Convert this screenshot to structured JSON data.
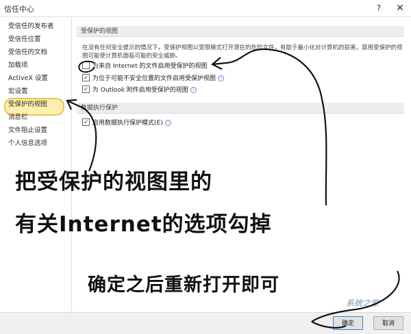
{
  "window": {
    "title": "信任中心",
    "help_label": "?",
    "close_label": "✕"
  },
  "sidebar": {
    "items": [
      {
        "label": "受信任的发布者"
      },
      {
        "label": "受信任位置"
      },
      {
        "label": "受信任的文档"
      },
      {
        "label": "加载项"
      },
      {
        "label": "ActiveX 设置"
      },
      {
        "label": "宏设置"
      },
      {
        "label": "受保护的视图"
      },
      {
        "label": "消息栏"
      },
      {
        "label": "文件阻止设置"
      },
      {
        "label": "个人信息选项"
      }
    ],
    "active_index": 6
  },
  "protected_view": {
    "header": "受保护的视图",
    "description": "在没有任何安全提示的情况下，受保护视图以受限模式打开潜在的危险文件，有助于最小化对计算机的损害。禁用受保护的视图可能使计算机面临可能的安全威胁。",
    "options": [
      {
        "label": "为来自 Internet 的文件启用受保护的视图",
        "checked": false,
        "info": false
      },
      {
        "label": "为位于可能不安全位置的文件启用受保护视图",
        "checked": true,
        "info": true
      },
      {
        "label": "为 Outlook 附件启用受保护的视图",
        "checked": true,
        "info": true
      }
    ]
  },
  "dep": {
    "header": "数据执行保护",
    "options": [
      {
        "label": "启用数据执行保护模式(E)",
        "checked": true,
        "info": true
      }
    ]
  },
  "annotations": {
    "line1": "把受保护的视图里的",
    "line2": "有关Internet的选项勾掉",
    "line3": "确定之后重新打开即可",
    "highlight_color": "#e8c44a",
    "ink_color": "#111111"
  },
  "buttons": {
    "ok": "确定",
    "cancel": "取消"
  },
  "watermark": "系统之家"
}
